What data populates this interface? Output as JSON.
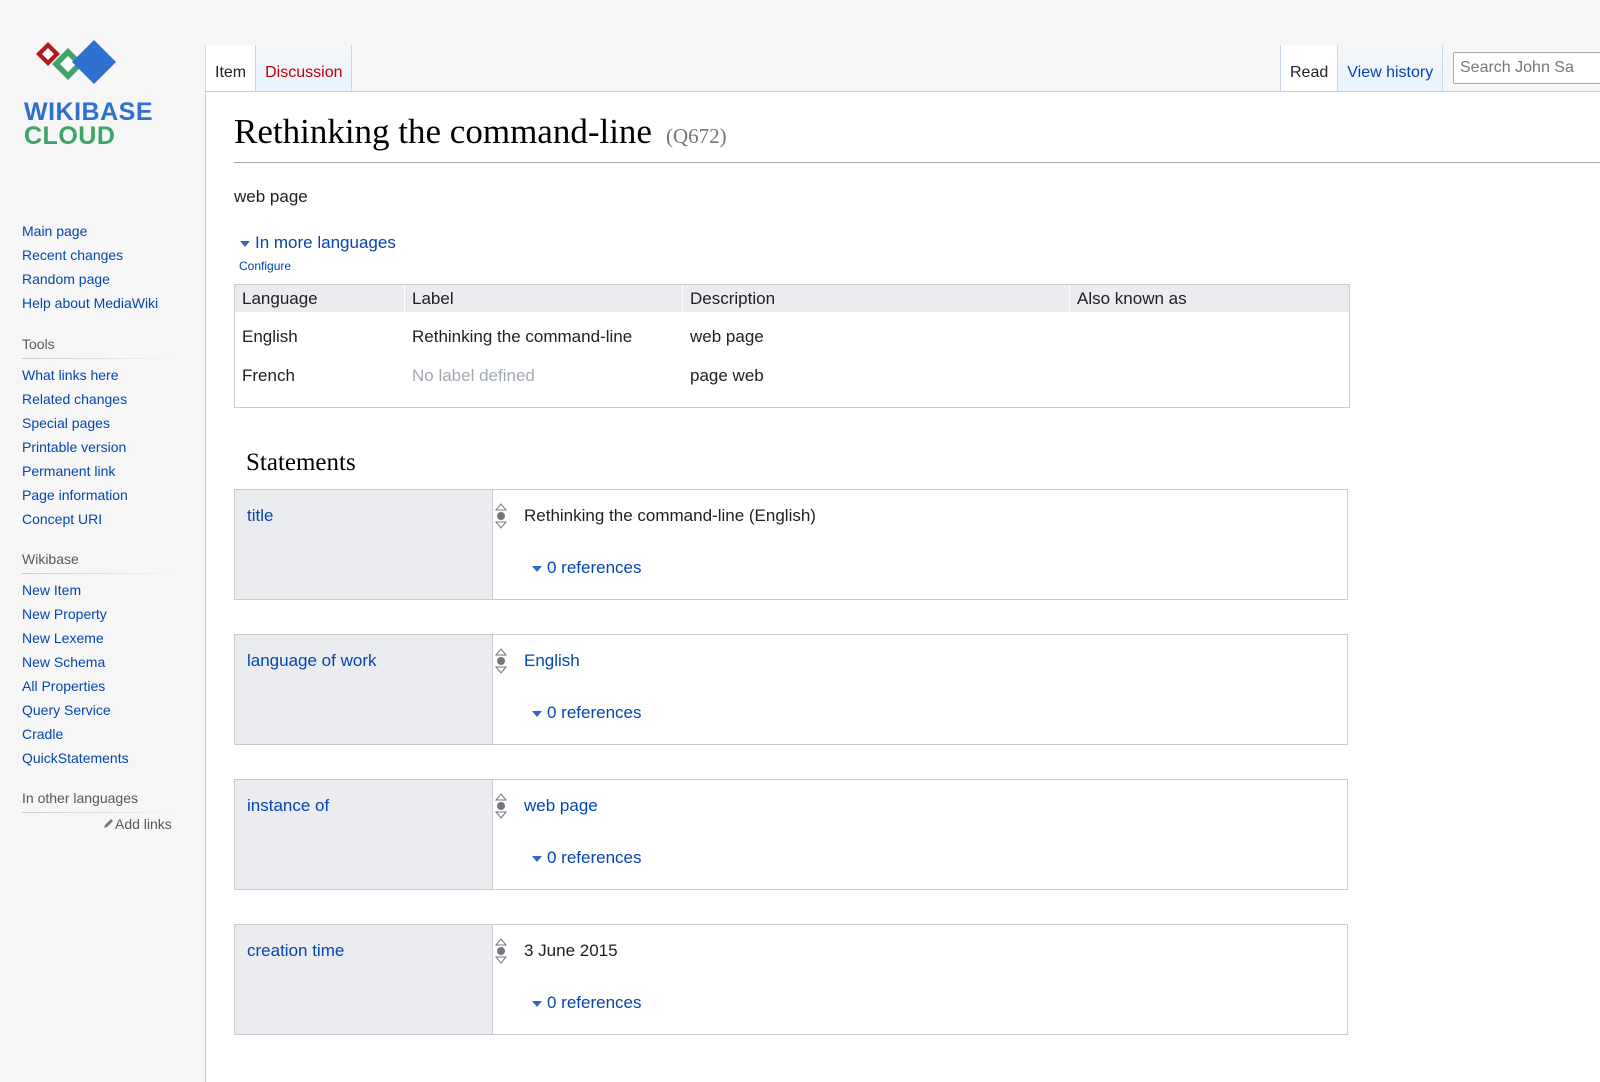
{
  "logo": {
    "line1": "WIKIBASE",
    "line2": "CLOUD"
  },
  "sidebar": {
    "navigation": [
      "Main page",
      "Recent changes",
      "Random page",
      "Help about MediaWiki"
    ],
    "tools": {
      "heading": "Tools",
      "items": [
        "What links here",
        "Related changes",
        "Special pages",
        "Printable version",
        "Permanent link",
        "Page information",
        "Concept URI"
      ]
    },
    "wikibase": {
      "heading": "Wikibase",
      "items": [
        "New Item",
        "New Property",
        "New Lexeme",
        "New Schema",
        "All Properties",
        "Query Service",
        "Cradle",
        "QuickStatements"
      ]
    },
    "languages": {
      "heading": "In other languages",
      "add_links": "Add links"
    }
  },
  "tabs": {
    "left": [
      "Item",
      "Discussion"
    ],
    "right": [
      "Read",
      "View history"
    ]
  },
  "search": {
    "placeholder": "Search John Sa"
  },
  "page": {
    "title": "Rethinking the command-line",
    "qid": "(Q672)",
    "description": "web page",
    "more_languages": "In more languages",
    "configure": "Configure"
  },
  "lang_table": {
    "headers": [
      "Language",
      "Label",
      "Description",
      "Also known as"
    ],
    "rows": [
      {
        "language": "English",
        "label": "Rethinking the command-line",
        "description": "web page",
        "aliases": ""
      },
      {
        "language": "French",
        "label": "No label defined",
        "description": "page web",
        "aliases": ""
      }
    ]
  },
  "statements": {
    "heading": "Statements",
    "items": [
      {
        "property": "title",
        "value": "Rethinking the command-line (English)",
        "value_is_link": false,
        "references": "0 references"
      },
      {
        "property": "language of work",
        "value": "English",
        "value_is_link": true,
        "references": "0 references"
      },
      {
        "property": "instance of",
        "value": "web page",
        "value_is_link": true,
        "references": "0 references"
      },
      {
        "property": "creation time",
        "value": "3 June 2015",
        "value_is_link": false,
        "references": "0 references"
      }
    ]
  },
  "colors": {
    "link": "#0645ad",
    "new_link": "#ba0000",
    "muted": "#a2a9b1",
    "logo_blue": "#2f6fce",
    "logo_green": "#3fa36a",
    "logo_red": "#b0181e"
  }
}
